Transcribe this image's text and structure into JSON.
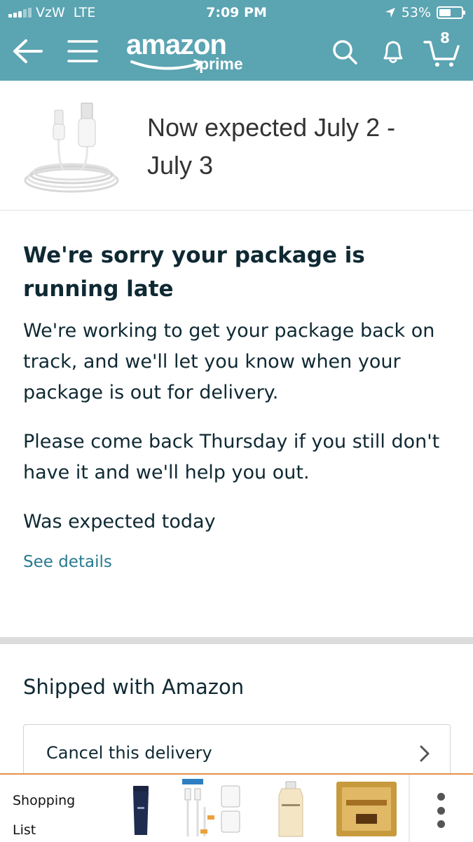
{
  "status_bar": {
    "carrier": "VzW",
    "network": "LTE",
    "time": "7:09 PM",
    "battery": "53%",
    "battery_level": 0.53
  },
  "header": {
    "logo_text": "amazon",
    "logo_sub": "prime",
    "cart_count": "8",
    "icons": [
      "back-arrow-icon",
      "menu-icon",
      "search-icon",
      "bell-icon",
      "cart-icon"
    ]
  },
  "delivery": {
    "expected_text": "Now expected July 2 - July 3"
  },
  "notice": {
    "heading": "We're sorry your package is running late",
    "paragraph1": "We're working to get your package back on track, and we'll let you know when your package is out for delivery.",
    "paragraph2": "Please come back Thursday if you still don't have it and we'll help you out.",
    "paragraph3": "Was expected today",
    "link": "See details"
  },
  "shipping": {
    "title": "Shipped with Amazon",
    "cancel_label": "Cancel this delivery"
  },
  "shopping_list": {
    "label_line1": "Shopping",
    "label_line2": "List",
    "more_icon": "more-vertical-icon"
  },
  "colors": {
    "header_bg": "#5ba4b2",
    "link": "#2a7a90",
    "text": "#0f2933",
    "bottom_border": "#e8904a"
  }
}
